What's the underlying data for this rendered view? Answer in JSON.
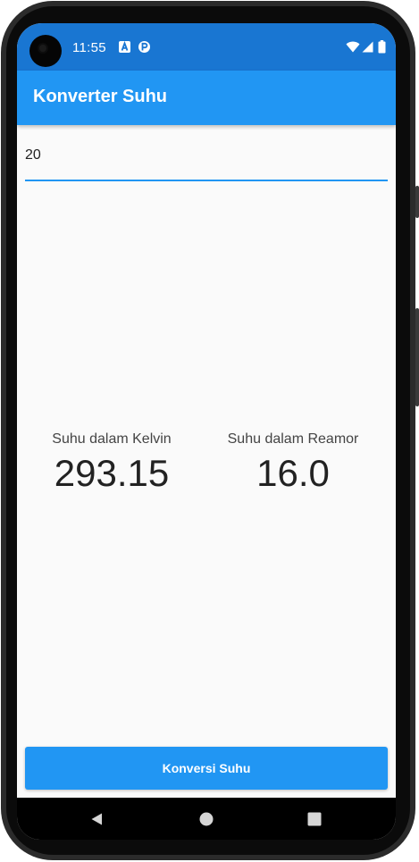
{
  "status_bar": {
    "time": "11:55",
    "notification_icons": [
      "a-box-icon",
      "p-circle-icon"
    ],
    "system_icons": [
      "wifi-icon",
      "signal-icon",
      "battery-icon"
    ]
  },
  "app_bar": {
    "title": "Konverter Suhu"
  },
  "input": {
    "value": "20"
  },
  "results": {
    "kelvin": {
      "label": "Suhu dalam Kelvin",
      "value": "293.15"
    },
    "reamur": {
      "label": "Suhu dalam Reamor",
      "value": "16.0"
    }
  },
  "convert_button": {
    "label": "Konversi Suhu"
  },
  "nav_bar": {
    "buttons": [
      "back-icon",
      "home-icon",
      "recents-icon"
    ]
  },
  "colors": {
    "status_bar": "#1976d2",
    "app_bar": "#2196f3",
    "accent": "#2196f3",
    "background": "#fafafa",
    "text_primary": "#222222"
  }
}
